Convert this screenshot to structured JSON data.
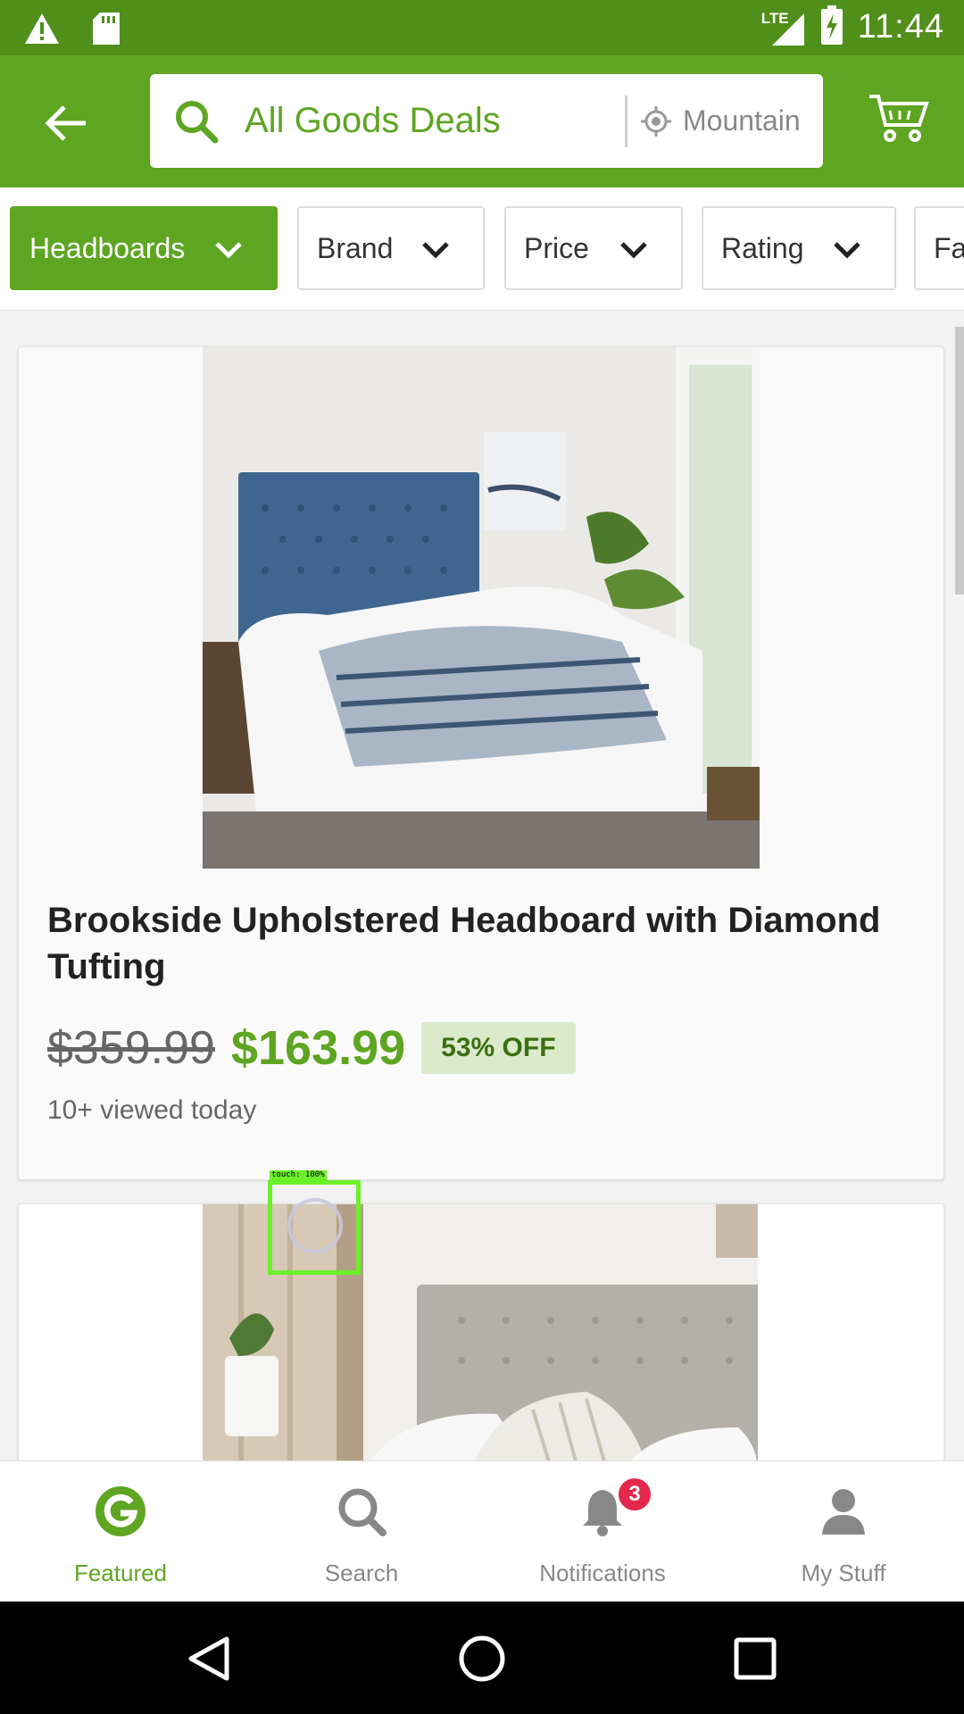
{
  "status_bar": {
    "time": "11:44",
    "network": "LTE",
    "icons": [
      "warning-icon",
      "sd-card-icon",
      "signal-icon",
      "battery-charging-icon"
    ]
  },
  "header": {
    "search_text": "All Goods Deals",
    "location": "Mountain View",
    "icons": [
      "back-arrow-icon",
      "search-icon",
      "location-icon",
      "cart-icon"
    ]
  },
  "filters": [
    {
      "label": "Headboards",
      "active": true
    },
    {
      "label": "Brand",
      "active": false
    },
    {
      "label": "Price",
      "active": false
    },
    {
      "label": "Rating",
      "active": false
    },
    {
      "label": "Fa",
      "active": false
    }
  ],
  "products": [
    {
      "title": "Brookside Upholstered Headboard with Diamond Tufting",
      "original_price": "$359.99",
      "price": "$163.99",
      "discount": "53% OFF",
      "views": "10+ viewed today"
    }
  ],
  "touch_overlay": {
    "label": "touch: 100%"
  },
  "bottom_nav": {
    "items": [
      {
        "label": "Featured",
        "icon": "groupon-g-icon",
        "active": true
      },
      {
        "label": "Search",
        "icon": "search-icon",
        "active": false
      },
      {
        "label": "Notifications",
        "icon": "bell-icon",
        "active": false,
        "badge": "3"
      },
      {
        "label": "My Stuff",
        "icon": "person-icon",
        "active": false
      }
    ]
  },
  "system_nav": {
    "icons": [
      "back-triangle-icon",
      "home-circle-icon",
      "recents-square-icon"
    ]
  },
  "colors": {
    "brand_green": "#5ea522",
    "status_green": "#4f8f1a",
    "badge_red": "#e5274b",
    "discount_bg": "#dbeacb"
  }
}
